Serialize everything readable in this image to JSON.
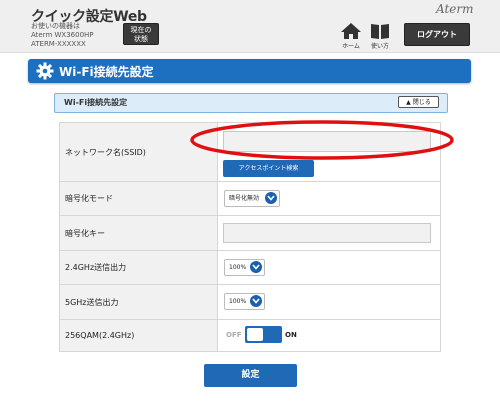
{
  "header": {
    "app_title": "クイック設定Web",
    "device_caption": [
      "お使いの機器は",
      "Aterm WX3600HP",
      "ATERM-XXXXXX"
    ],
    "status_button": [
      "現在の",
      "状態"
    ],
    "brand": "Aterm",
    "nav": [
      {
        "label": "ホーム",
        "icon": "home-icon"
      },
      {
        "label": "使い方",
        "icon": "book-icon"
      }
    ],
    "logout_label": "ログアウト"
  },
  "section": {
    "title": "Wi-Fi接続先設定",
    "icon": "gear-icon",
    "accent": "#1d6fc0"
  },
  "panel": {
    "title": "Wi-Fi接続先設定",
    "close_label": "閉じる"
  },
  "form": {
    "rows": [
      {
        "label": "ネットワーク名(SSID)",
        "value": "",
        "button": "アクセスポイント検索"
      },
      {
        "label": "暗号化モード",
        "selected": "暗号化無効"
      },
      {
        "label": "暗号化キー",
        "value": ""
      },
      {
        "label": "2.4GHz送信出力",
        "selected": "100%"
      },
      {
        "label": "5GHz送信出力",
        "selected": "100%"
      },
      {
        "label": "256QAM(2.4GHz)",
        "off_label": "OFF",
        "on_label": "ON",
        "state": "ON"
      }
    ]
  },
  "submit_label": "設定",
  "annotation": {
    "color": "#e01010"
  }
}
